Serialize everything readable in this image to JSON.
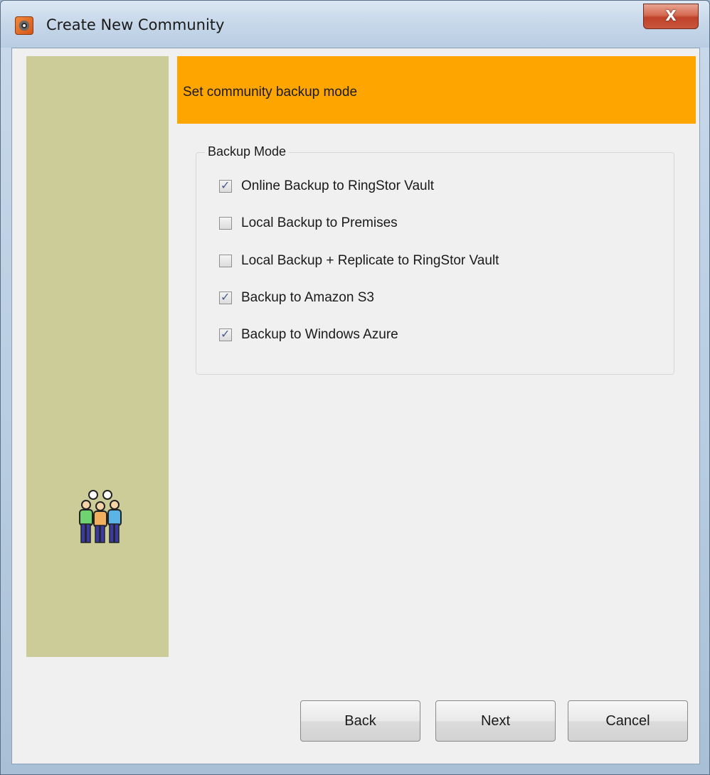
{
  "window": {
    "title": "Create New Community",
    "close_label": "X"
  },
  "header": {
    "text": "Set community backup mode",
    "color": "#ffa500"
  },
  "sidebar": {
    "color": "#cccc99",
    "icon": "community-people-icon"
  },
  "backup_mode": {
    "legend": "Backup Mode",
    "options": [
      {
        "label": "Online Backup to RingStor Vault",
        "checked": true
      },
      {
        "label": "Local Backup to Premises",
        "checked": false
      },
      {
        "label": "Local Backup + Replicate to RingStor Vault",
        "checked": false
      },
      {
        "label": "Backup to Amazon S3",
        "checked": true
      },
      {
        "label": "Backup to Windows Azure",
        "checked": true
      }
    ]
  },
  "buttons": {
    "back": "Back",
    "next": "Next",
    "cancel": "Cancel"
  }
}
